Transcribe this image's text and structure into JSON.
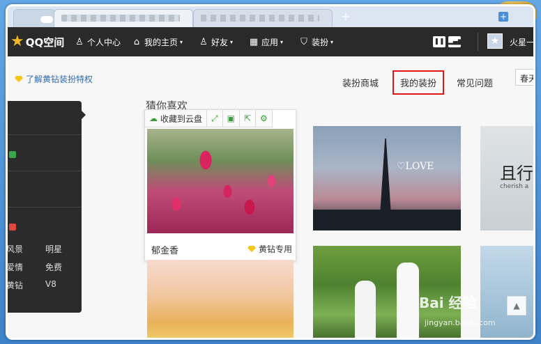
{
  "browser": {
    "new_tab_symbol": "+"
  },
  "qqbar": {
    "logo_text": "QQ空间",
    "nav": [
      {
        "label": "个人中心",
        "icon": "person-icon"
      },
      {
        "label": "我的主页",
        "icon": "home-icon",
        "has_menu": true
      },
      {
        "label": "好友",
        "icon": "friends-icon",
        "has_menu": true
      },
      {
        "label": "应用",
        "icon": "apps-icon",
        "has_menu": true
      },
      {
        "label": "装扮",
        "icon": "shirt-icon",
        "has_menu": true
      }
    ],
    "caret": "▾",
    "username": "火星一"
  },
  "content": {
    "vip_link": "了解黄钻装扮特权",
    "tabs": [
      "装扮商城",
      "我的装扮",
      "常见问题"
    ],
    "active_tab": "我的装扮",
    "season_select": "春天",
    "section_title": "猜你喜欢"
  },
  "leftpanel": {
    "items": [
      {
        "label": "风景"
      },
      {
        "label": "明星"
      },
      {
        "label": "爱情"
      },
      {
        "label": "免费"
      },
      {
        "label": "黄钻"
      },
      {
        "label": "V8"
      }
    ],
    "badge_colors": [
      "#3aa64a",
      "#e0463c"
    ]
  },
  "hover_toolbar": {
    "save_cloud": "收藏到云盘"
  },
  "cards": [
    {
      "caption": "郁金香",
      "badge": "黄钻专用"
    }
  ],
  "thumb_texts": {
    "love": "♡LOVE",
    "quote_big": "且行，",
    "quote_small": "cherish a"
  },
  "watermark": {
    "main": "Bai 经验",
    "sub": "jingyan.baidu.com"
  },
  "colors": {
    "nav_bg": "#2a2a2a",
    "active_outline": "#e01515",
    "link": "#2f6ab0",
    "toolbar_icon": "#3a9b3a",
    "diamond": "#f5c518"
  }
}
